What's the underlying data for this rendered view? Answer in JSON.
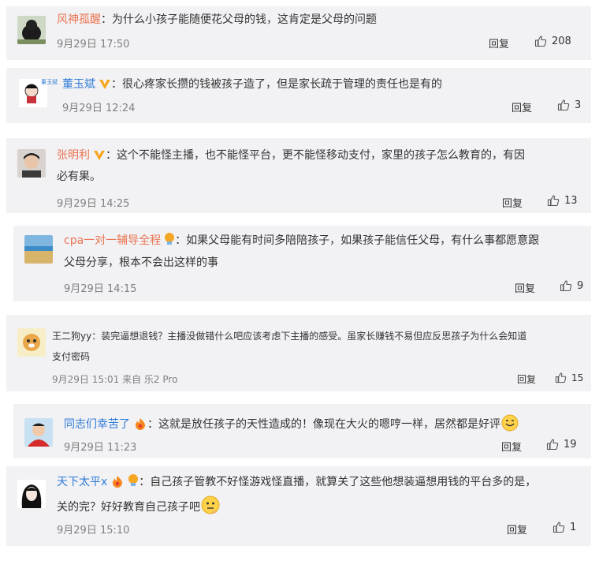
{
  "comments": [
    {
      "name": "风神孤醒",
      "text": "：为什么小孩子能随便花父母的钱，这肯定是父母的问题",
      "date": "9月29日 17:50",
      "reply": "回复",
      "likes": "208"
    },
    {
      "name": "董玉斌",
      "text": "：很心疼家长攒的钱被孩子造了，但是家长疏于管理的责任也是有的",
      "date": "9月29日 12:24",
      "reply": "回复",
      "likes": "3"
    },
    {
      "name": "张明利",
      "text1": "：这个不能怪主播，也不能怪平台，更不能怪移动支付，家里的孩子怎么教育的，有因",
      "text2": "必有果。",
      "date": "9月29日 14:25",
      "reply": "回复",
      "likes": "13"
    },
    {
      "name": "cpa一对一辅导全程",
      "text1": "：如果父母能有时间多陪陪孩子，如果孩子能信任父母，有什么事都愿意跟",
      "text2": "父母分享，根本不会出这样的事",
      "date": "9月29日 14:15",
      "reply": "回复",
      "likes": "9"
    },
    {
      "name": "王二狗yy",
      "text1": "：装完逼想退钱？主播没做错什么吧应该考虑下主播的感受。虽家长赚钱不易但应反思孩子为什么会知道",
      "text2": "支付密码",
      "date": "9月29日 15:01 来自 乐2 Pro",
      "reply": "回复",
      "likes": "15"
    },
    {
      "name": "同志们幸苦了",
      "text": "：这就是放任孩子的天性造成的！像现在大火的嗯哼一样，居然都是好评",
      "date": "9月29日 11:23",
      "reply": "回复",
      "likes": "19"
    },
    {
      "name": "天下太平x",
      "text1": "：自己孩子管教不好怪游戏怪直播，就算关了这些他想装逼想用钱的平台多的是，",
      "text2": "关的完？好好教育自己孩子吧",
      "date": "9月29日 15:10",
      "reply": "回复",
      "likes": "1"
    }
  ],
  "avatar2_caption": "董玉斌",
  "colors": {
    "card_bg": "#f2f2f5",
    "name_orange": "#eb7350",
    "name_blue": "#2f7bd6",
    "vip_orange": "#f7a51c"
  }
}
